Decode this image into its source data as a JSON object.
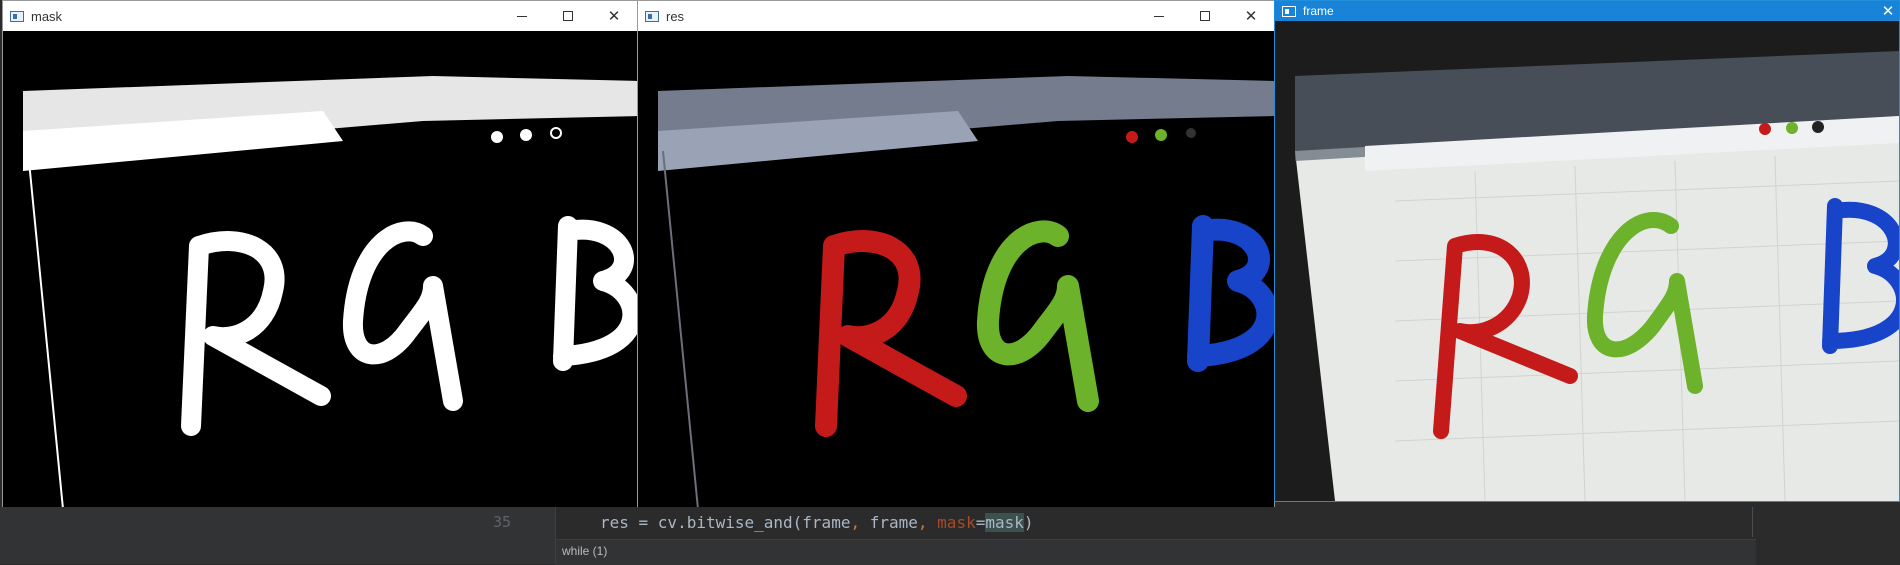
{
  "windows": {
    "mask": {
      "title": "mask",
      "letters": [
        "R",
        "G",
        "B"
      ]
    },
    "res": {
      "title": "res",
      "letters": [
        "R",
        "G",
        "B"
      ]
    },
    "frame": {
      "title": "frame",
      "letters": [
        "R",
        "G",
        "B"
      ]
    }
  },
  "editor": {
    "line_number": "35",
    "code_tokens": {
      "lhs": "res = cv.bitwise_and(frame",
      "comma1": ",",
      "mid": " frame",
      "comma2": ",",
      "space": " ",
      "param": "mask",
      "eq": "=",
      "arg": "mask",
      "close": ")"
    },
    "breadcrumb": "while (1)"
  },
  "colors": {
    "red": "#c41a1a",
    "green": "#6cb22a",
    "blue": "#1744c8",
    "titlebar_active": "#1883d7",
    "editor_bg": "#2b2b2b"
  },
  "icons": [
    "window-app-icon",
    "minimize-icon",
    "maximize-icon",
    "close-icon"
  ]
}
